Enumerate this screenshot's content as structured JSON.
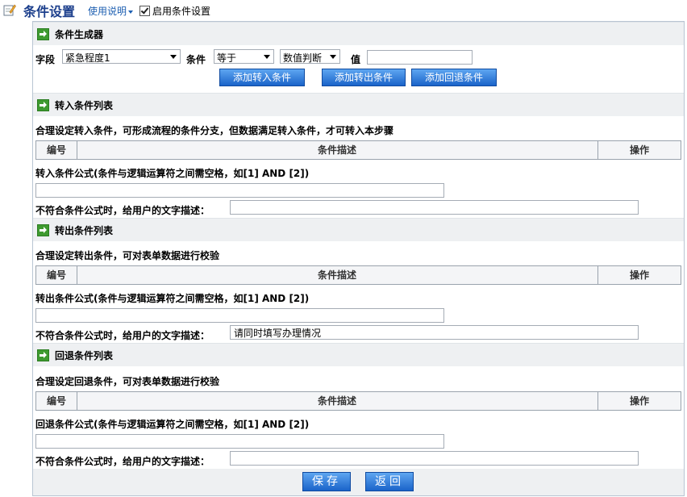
{
  "header": {
    "title": "条件设置",
    "help_label": "使用说明",
    "enable_label": "启用条件设置",
    "enable_checked": true
  },
  "generator": {
    "section_title": "条件生成器",
    "field_label": "字段",
    "field_value": "紧急程度1",
    "condition_label": "条件",
    "operator_value": "等于",
    "judge_value": "数值判断",
    "value_label": "值",
    "value_input": "",
    "buttons": {
      "add_in": "添加转入条件",
      "add_out": "添加转出条件",
      "add_back": "添加回退条件"
    }
  },
  "sections": [
    {
      "title": "转入条件列表",
      "desc": "合理设定转入条件，可形成流程的条件分支，但数据满足转入条件，才可转入本步骤",
      "columns": [
        "编号",
        "条件描述",
        "操作"
      ],
      "formula_label": "转入条件公式(条件与逻辑运算符之间需空格，如[1] AND [2])",
      "formula_value": "",
      "msg_label": "不符合条件公式时，给用户的文字描述：",
      "msg_value": ""
    },
    {
      "title": "转出条件列表",
      "desc": "合理设定转出条件，可对表单数据进行校验",
      "columns": [
        "编号",
        "条件描述",
        "操作"
      ],
      "formula_label": "转出条件公式(条件与逻辑运算符之间需空格，如[1] AND [2])",
      "formula_value": "",
      "msg_label": "不符合条件公式时，给用户的文字描述：",
      "msg_value": "请同时填写办理情况"
    },
    {
      "title": "回退条件列表",
      "desc": "合理设定回退条件，可对表单数据进行校验",
      "columns": [
        "编号",
        "条件描述",
        "操作"
      ],
      "formula_label": "回退条件公式(条件与逻辑运算符之间需空格，如[1] AND [2])",
      "formula_value": "",
      "msg_label": "不符合条件公式时，给用户的文字描述：",
      "msg_value": ""
    }
  ],
  "footer": {
    "save_label": "保存",
    "back_label": "返回"
  }
}
